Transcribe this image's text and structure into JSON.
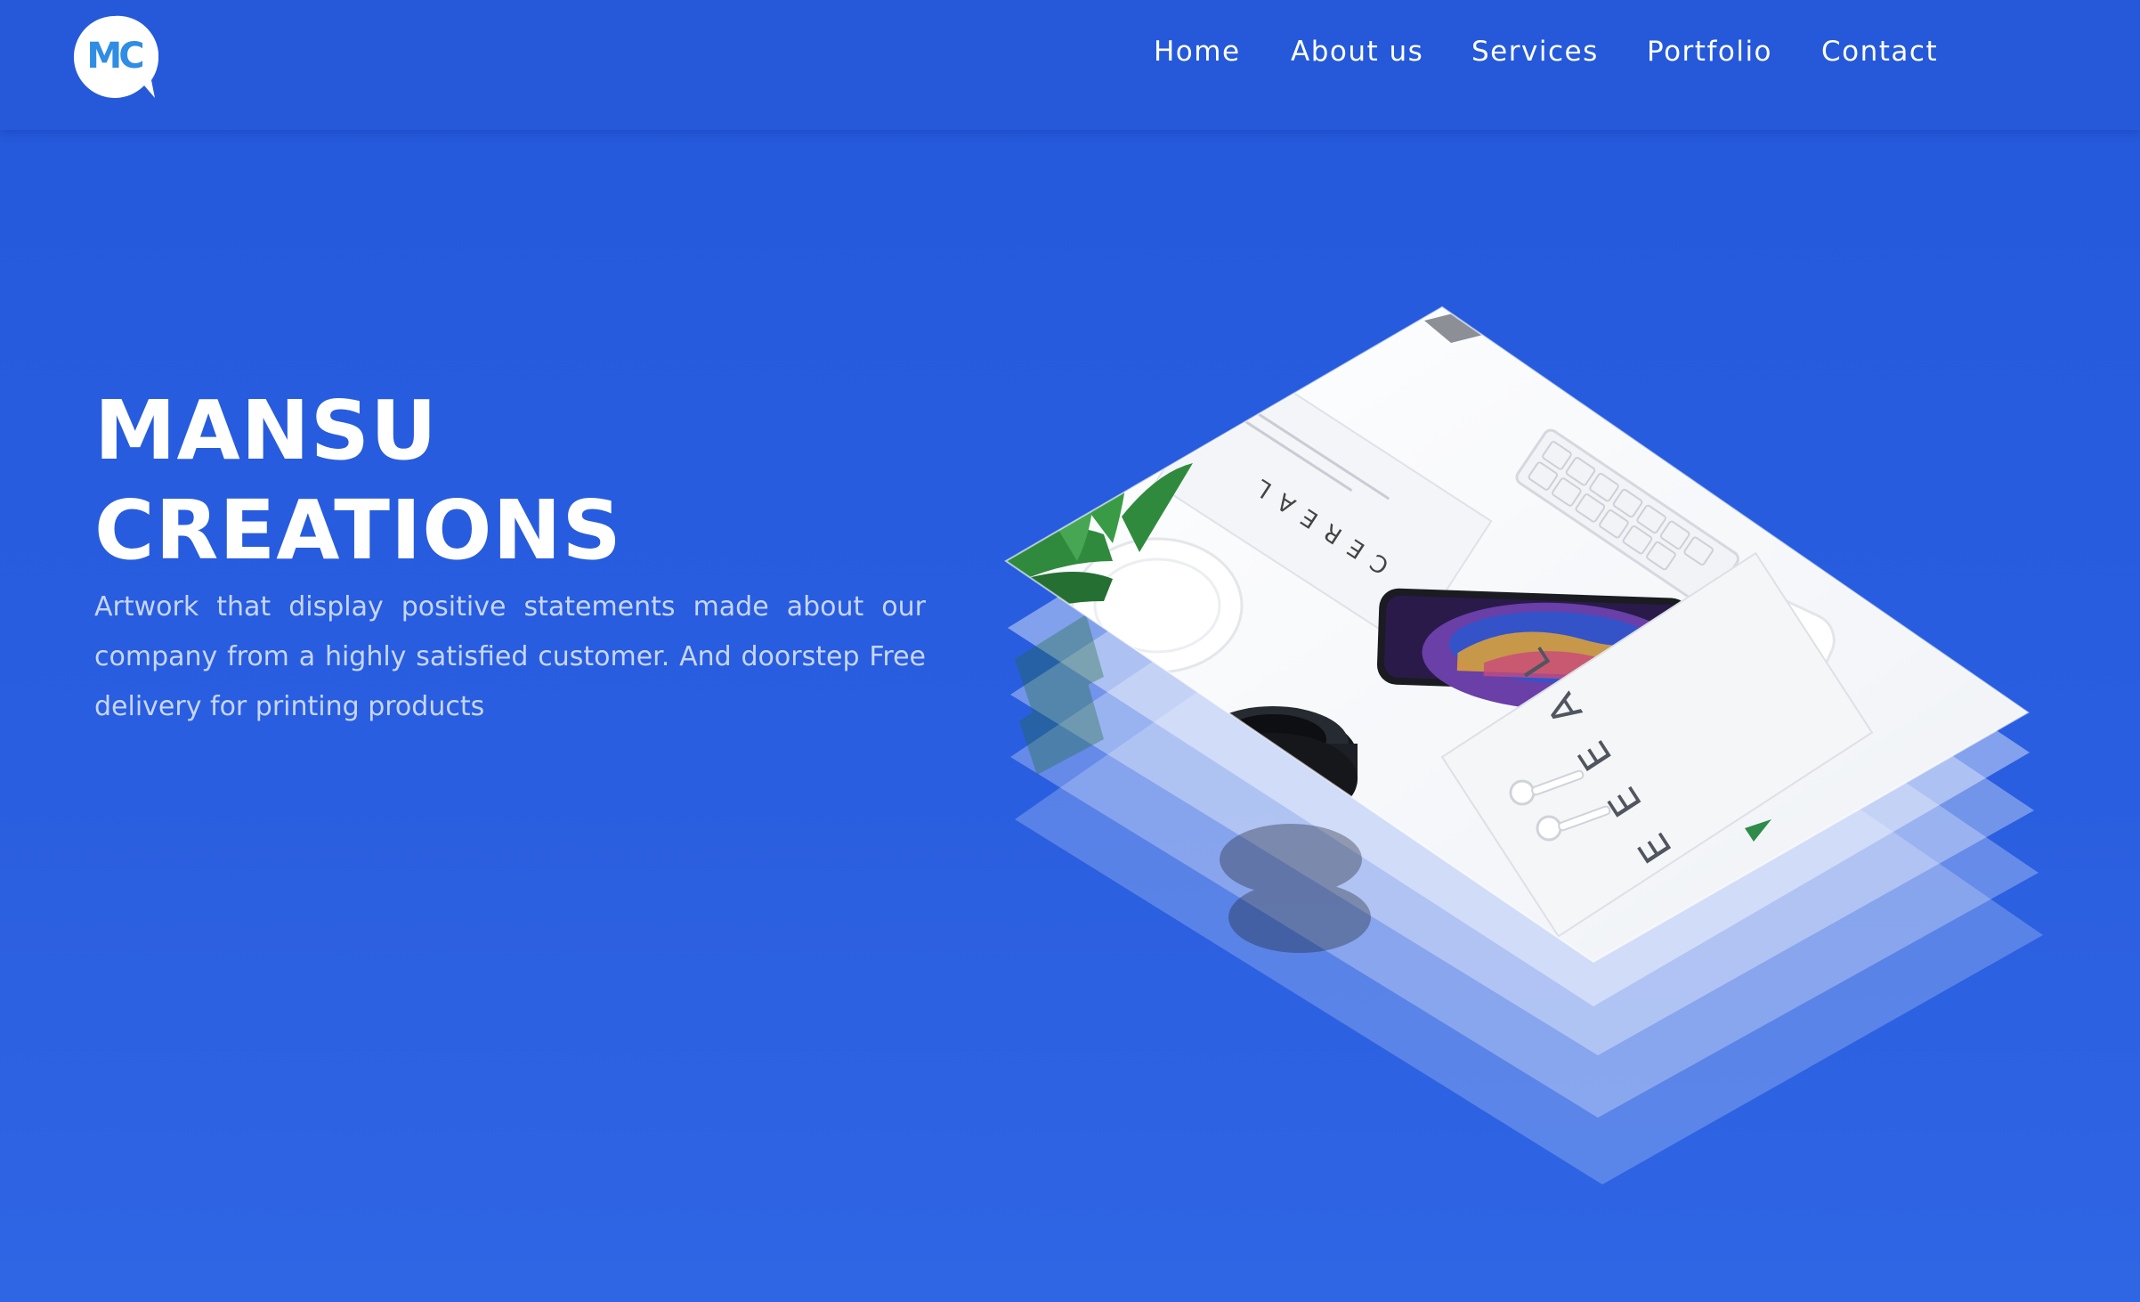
{
  "brand": {
    "logo_text": "MC",
    "accent_color": "#2459db",
    "logo_color": "#2f8de4"
  },
  "nav": {
    "items": [
      {
        "label": "Home"
      },
      {
        "label": "About us"
      },
      {
        "label": "Services"
      },
      {
        "label": "Portfolio"
      },
      {
        "label": "Contact"
      }
    ]
  },
  "hero": {
    "title_line1": "MANSU",
    "title_line2": "CREATIONS",
    "description": "Artwork that display positive statements made about our company from a highly satisfied customer. And doorstep Free delivery for printing products"
  },
  "illustration": {
    "magazine_top_text": "CEREAL",
    "magazine_bottom_text": "E E E A L",
    "icons": [
      "stacked-layers-icon",
      "phone-icon",
      "camera-lens-icon",
      "earbuds-icon",
      "keyboard-icon",
      "plant-icon"
    ]
  }
}
